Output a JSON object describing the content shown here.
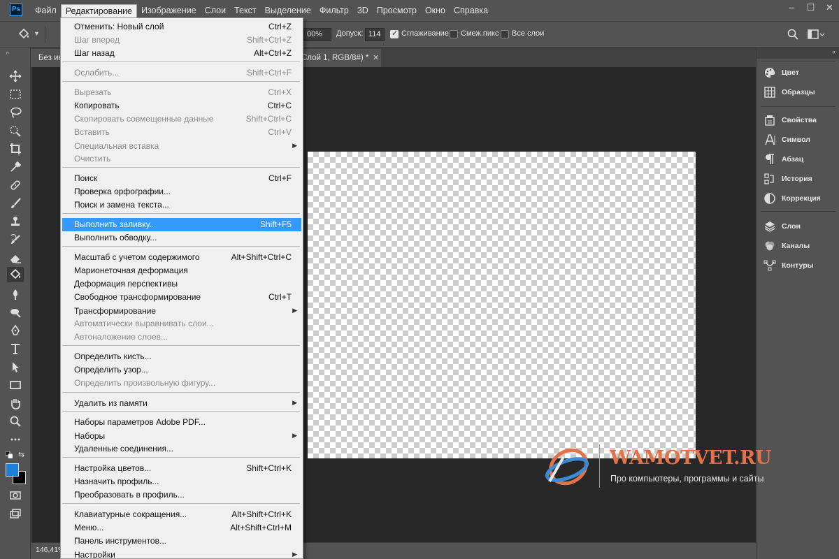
{
  "app": {
    "logo": "Ps",
    "menus": [
      "Файл",
      "Редактирование",
      "Изображение",
      "Слои",
      "Текст",
      "Выделение",
      "Фильтр",
      "3D",
      "Просмотр",
      "Окно",
      "Справка"
    ],
    "active_menu_index": 1,
    "window_controls": [
      "–",
      "☐",
      "✕"
    ]
  },
  "options_bar": {
    "opacity_value": "00%",
    "tolerance_label": "Допуск:",
    "tolerance_value": "114",
    "antialias_label": "Сглаживание",
    "antialias_checked": true,
    "contiguous_label": "Смеж.пикс",
    "contiguous_checked": false,
    "all_layers_label": "Все слои",
    "all_layers_checked": false
  },
  "document": {
    "tab_title_left": "Без ин",
    "tab_title_right": "Слой 1, RGB/8#) *",
    "tab_close": "✕",
    "zoom": "146,41%"
  },
  "edit_menu": {
    "items": [
      {
        "label": "Отменить: Новый слой",
        "shortcut": "Ctrl+Z",
        "disabled": false
      },
      {
        "label": "Шаг вперед",
        "shortcut": "Shift+Ctrl+Z",
        "disabled": true
      },
      {
        "label": "Шаг назад",
        "shortcut": "Alt+Ctrl+Z",
        "disabled": false
      },
      {
        "label": "Ослабить...",
        "shortcut": "Shift+Ctrl+F",
        "disabled": true
      },
      {
        "label": "Вырезать",
        "shortcut": "Ctrl+X",
        "disabled": true
      },
      {
        "label": "Копировать",
        "shortcut": "Ctrl+C",
        "disabled": false
      },
      {
        "label": "Скопировать совмещенные данные",
        "shortcut": "Shift+Ctrl+C",
        "disabled": true
      },
      {
        "label": "Вставить",
        "shortcut": "Ctrl+V",
        "disabled": true
      },
      {
        "label": "Специальная вставка",
        "shortcut": "",
        "disabled": true,
        "submenu": true
      },
      {
        "label": "Очистить",
        "shortcut": "",
        "disabled": true
      },
      {
        "label": "Поиск",
        "shortcut": "Ctrl+F",
        "disabled": false
      },
      {
        "label": "Проверка орфографии...",
        "shortcut": "",
        "disabled": false
      },
      {
        "label": "Поиск и замена текста...",
        "shortcut": "",
        "disabled": false
      },
      {
        "label": "Выполнить заливку...",
        "shortcut": "Shift+F5",
        "disabled": false,
        "highlighted": true
      },
      {
        "label": "Выполнить обводку...",
        "shortcut": "",
        "disabled": false
      },
      {
        "label": "Масштаб с учетом содержимого",
        "shortcut": "Alt+Shift+Ctrl+C",
        "disabled": false
      },
      {
        "label": "Марионеточная деформация",
        "shortcut": "",
        "disabled": false
      },
      {
        "label": "Деформация перспективы",
        "shortcut": "",
        "disabled": false
      },
      {
        "label": "Свободное трансформирование",
        "shortcut": "Ctrl+T",
        "disabled": false
      },
      {
        "label": "Трансформирование",
        "shortcut": "",
        "disabled": false,
        "submenu": true
      },
      {
        "label": "Автоматически выравнивать слои...",
        "shortcut": "",
        "disabled": true
      },
      {
        "label": "Автоналожение слоев...",
        "shortcut": "",
        "disabled": true
      },
      {
        "label": "Определить кисть...",
        "shortcut": "",
        "disabled": false
      },
      {
        "label": "Определить узор...",
        "shortcut": "",
        "disabled": false
      },
      {
        "label": "Определить произвольную фигуру...",
        "shortcut": "",
        "disabled": true
      },
      {
        "label": "Удалить из памяти",
        "shortcut": "",
        "disabled": false,
        "submenu": true
      },
      {
        "label": "Наборы параметров Adobe PDF...",
        "shortcut": "",
        "disabled": false
      },
      {
        "label": "Наборы",
        "shortcut": "",
        "disabled": false,
        "submenu": true
      },
      {
        "label": "Удаленные соединения...",
        "shortcut": "",
        "disabled": false
      },
      {
        "label": "Настройка цветов...",
        "shortcut": "Shift+Ctrl+K",
        "disabled": false
      },
      {
        "label": "Назначить профиль...",
        "shortcut": "",
        "disabled": false
      },
      {
        "label": "Преобразовать в профиль...",
        "shortcut": "",
        "disabled": false
      },
      {
        "label": "Клавиатурные сокращения...",
        "shortcut": "Alt+Shift+Ctrl+K",
        "disabled": false
      },
      {
        "label": "Меню...",
        "shortcut": "Alt+Shift+Ctrl+M",
        "disabled": false
      },
      {
        "label": "Панель инструментов...",
        "shortcut": "",
        "disabled": false
      },
      {
        "label": "Настройки",
        "shortcut": "",
        "disabled": false,
        "submenu": true
      }
    ]
  },
  "panels": {
    "group1": [
      {
        "label": "Цвет",
        "icon": "palette-icon"
      },
      {
        "label": "Образцы",
        "icon": "swatches-icon"
      }
    ],
    "group2": [
      {
        "label": "Свойства",
        "icon": "properties-icon"
      },
      {
        "label": "Символ",
        "icon": "character-icon"
      },
      {
        "label": "Абзац",
        "icon": "paragraph-icon"
      },
      {
        "label": "История",
        "icon": "history-icon"
      },
      {
        "label": "Коррекция",
        "icon": "adjustments-icon"
      }
    ],
    "group3": [
      {
        "label": "Слои",
        "icon": "layers-icon"
      },
      {
        "label": "Каналы",
        "icon": "channels-icon"
      },
      {
        "label": "Контуры",
        "icon": "paths-icon"
      }
    ]
  },
  "watermark": {
    "title": "WAMOTVET.RU",
    "subtitle": "Про компьютеры, программы и сайты"
  },
  "colors": {
    "foreground": "#1e7fd6",
    "background": "#000000",
    "highlight": "#3399ff",
    "watermark": "#e2724a"
  }
}
